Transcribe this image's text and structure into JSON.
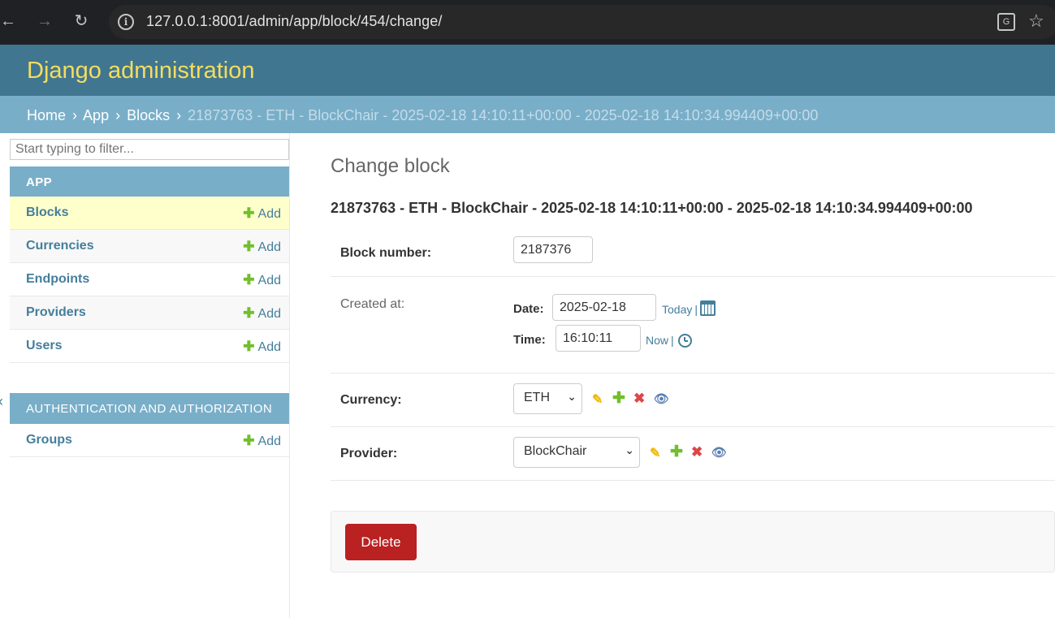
{
  "browser": {
    "url": "127.0.0.1:8001/admin/app/block/454/change/"
  },
  "header": {
    "site_title": "Django administration"
  },
  "breadcrumbs": {
    "home": "Home",
    "app": "App",
    "model": "Blocks",
    "current": "21873763 - ETH - BlockChair - 2025-02-18 14:10:11+00:00 - 2025-02-18 14:10:34.994409+00:00",
    "separator": "›"
  },
  "sidebar": {
    "filter_placeholder": "Start typing to filter...",
    "app_module": {
      "caption": "APP",
      "items": [
        {
          "label": "Blocks",
          "add": "Add"
        },
        {
          "label": "Currencies",
          "add": "Add"
        },
        {
          "label": "Endpoints",
          "add": "Add"
        },
        {
          "label": "Providers",
          "add": "Add"
        },
        {
          "label": "Users",
          "add": "Add"
        }
      ]
    },
    "auth_module": {
      "caption": "AUTHENTICATION AND AUTHORIZATION",
      "items": [
        {
          "label": "Groups",
          "add": "Add"
        }
      ]
    }
  },
  "main": {
    "page_title": "Change block",
    "object_title": "21873763 - ETH - BlockChair - 2025-02-18 14:10:11+00:00 - 2025-02-18 14:10:34.994409+00:00",
    "block_number": {
      "label": "Block number:",
      "value": "2187376"
    },
    "created_at": {
      "label": "Created at:",
      "date_label": "Date:",
      "date_value": "2025-02-18",
      "today": "Today",
      "time_label": "Time:",
      "time_value": "16:10:11",
      "now": "Now",
      "bar": "|"
    },
    "currency": {
      "label": "Currency:",
      "selected": "ETH"
    },
    "provider": {
      "label": "Provider:",
      "selected": "BlockChair"
    },
    "delete_label": "Delete"
  },
  "icons": {
    "back": "arrow-left-icon",
    "forward": "arrow-right-icon",
    "reload": "reload-icon",
    "info": "info-icon",
    "translate": "translate-icon",
    "bookmark": "star-icon",
    "calendar": "calendar-icon",
    "clock": "clock-icon",
    "edit": "pencil-icon",
    "add": "plus-icon",
    "delete": "x-icon",
    "view": "eye-icon"
  },
  "colors": {
    "header_bg": "#417690",
    "site_title": "#f5dd5d",
    "breadcrumbs_bg": "#79aec8",
    "link": "#447e9b",
    "add_green": "#70bf2b",
    "delete_red": "#ba2121",
    "current_row": "#ffffcc"
  }
}
